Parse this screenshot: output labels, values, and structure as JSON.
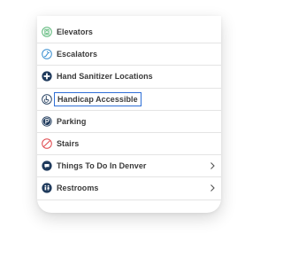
{
  "menu": {
    "items": [
      {
        "label": "Elevators",
        "icon": "elevator-icon",
        "has_chevron": false
      },
      {
        "label": "Escalators",
        "icon": "escalator-icon",
        "has_chevron": false
      },
      {
        "label": "Hand Sanitizer Locations",
        "icon": "plus-circle-icon",
        "has_chevron": false
      },
      {
        "label": "Handicap Accessible",
        "icon": "wheelchair-icon",
        "has_chevron": false,
        "focused": true
      },
      {
        "label": "Parking",
        "icon": "parking-icon",
        "has_chevron": false
      },
      {
        "label": "Stairs",
        "icon": "stairs-icon",
        "has_chevron": false
      },
      {
        "label": "Things To Do In Denver",
        "icon": "speech-bubble-icon",
        "has_chevron": true
      },
      {
        "label": "Restrooms",
        "icon": "restroom-icon",
        "has_chevron": true
      }
    ]
  },
  "colors": {
    "elevator_icon": "#5cb87a",
    "escalator_icon": "#3a8fd1",
    "dark_icon": "#1f3a5c",
    "stairs_icon": "#e0474c",
    "focus_outline": "#2f6fd6"
  }
}
